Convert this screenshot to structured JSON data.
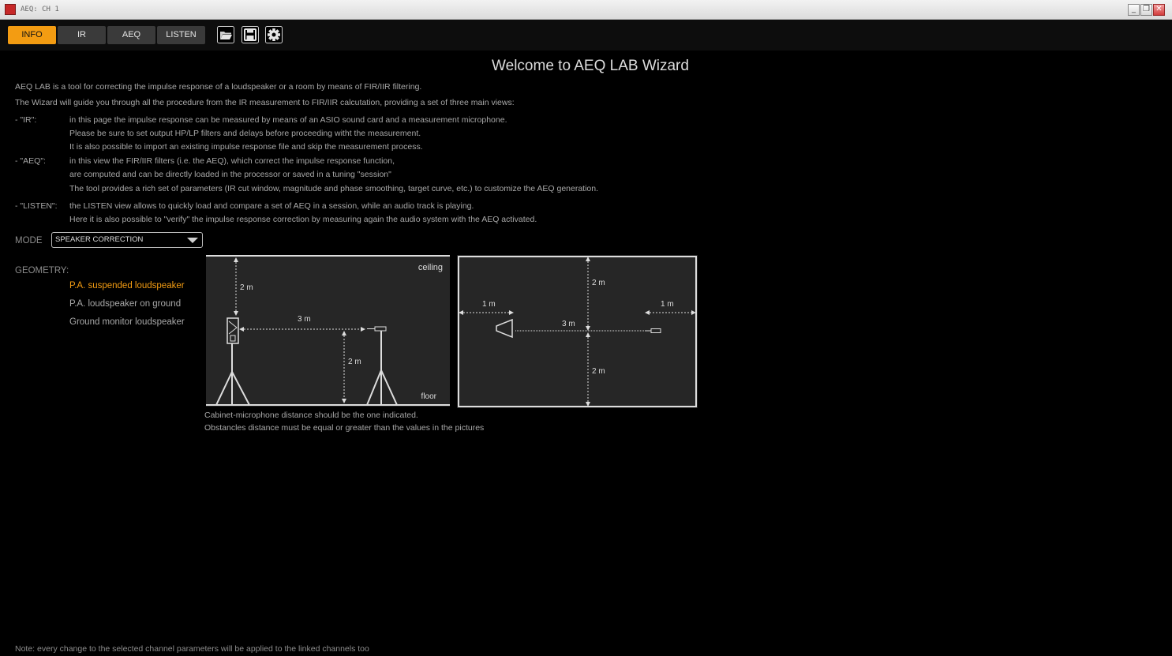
{
  "window": {
    "title": "AEQ: CH 1",
    "controls": [
      "minimize",
      "restore",
      "close"
    ]
  },
  "tabs": [
    {
      "label": "INFO",
      "active": true
    },
    {
      "label": "IR",
      "active": false
    },
    {
      "label": "AEQ",
      "active": false
    },
    {
      "label": "LISTEN",
      "active": false
    }
  ],
  "toolbar_icons": [
    "folder-open-icon",
    "save-icon",
    "gear-icon"
  ],
  "heading": "Welcome to AEQ LAB Wizard",
  "intro": [
    "AEQ LAB is a tool for correcting the impulse response of a loudspeaker or a room by means of FIR/IIR filtering.",
    "The Wizard will guide you through all the procedure from the IR measurement to FIR/IIR calcutation, providing a set of three main views:"
  ],
  "views": [
    {
      "key": "- \"IR\":",
      "lines": [
        "in this page the impulse response can be measured by means of an ASIO sound card and a measurement microphone.",
        "Please be sure to set output HP/LP filters and delays before proceeding witht the measurement.",
        "It is also possible to import an existing impulse response file and skip the measurement process."
      ]
    },
    {
      "key": "- \"AEQ\":",
      "lines": [
        "in this view the FIR/IIR filters (i.e. the AEQ), which correct the impulse response function,",
        "are computed and can be directly loaded in the processor or saved in a tuning \"session\"",
        "The tool provides a rich set of parameters (IR cut window, magnitude and phase smoothing, target curve, etc.) to customize the AEQ generation."
      ]
    },
    {
      "key": "- \"LISTEN\":",
      "lines": [
        "the LISTEN view allows to quickly load and compare a set of AEQ in a session, while an audio track is playing.",
        "Here it is also possible to \"verify\" the impulse response correction by measuring again the audio system with the AEQ activated."
      ]
    }
  ],
  "mode": {
    "label": "MODE",
    "value": "SPEAKER CORRECTION"
  },
  "geometry": {
    "label": "GEOMETRY:",
    "options": [
      {
        "label": "P.A. suspended loudspeaker",
        "selected": true
      },
      {
        "label": "P.A. loudspeaker on ground",
        "selected": false
      },
      {
        "label": "Ground monitor loudspeaker",
        "selected": false
      }
    ]
  },
  "side_diagram": {
    "ceiling": "ceiling",
    "floor": "floor",
    "top_gap": "2 m",
    "distance": "3 m",
    "height": "2 m"
  },
  "top_diagram": {
    "top_gap": "2 m",
    "left_gap": "1 m",
    "right_gap": "1 m",
    "distance": "3 m",
    "bottom_gap": "2 m"
  },
  "captions": [
    "Cabinet-microphone distance should be the one indicated.",
    "Obstancles distance must be equal or greater than the values in the pictures"
  ],
  "note": "Note: every change to the selected channel parameters will be applied to the linked channels too",
  "colors": {
    "accent": "#f39c12",
    "tab_inactive": "#3a3a3a",
    "background": "#000000",
    "panel": "#262626"
  }
}
